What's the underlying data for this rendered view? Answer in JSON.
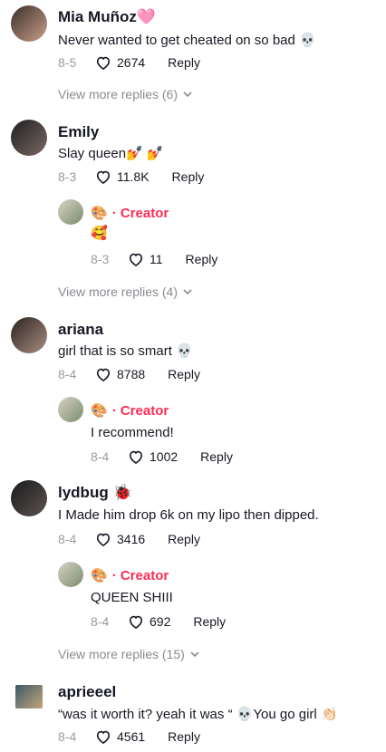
{
  "comments": [
    {
      "name": "Mia Muñoz🩷",
      "text": "Never wanted to get cheated on so bad",
      "emoji": "💀",
      "date": "8-5",
      "likes": "2674",
      "reply_label": "Reply",
      "more_replies": "View more replies (6)"
    },
    {
      "name": "Emily",
      "text": "Slay queen",
      "emoji": "💅 💅",
      "date": "8-3",
      "likes": "11.8K",
      "reply_label": "Reply",
      "reply": {
        "badge": "🎨",
        "creator": "· Creator",
        "text": "🥰",
        "date": "8-3",
        "likes": "11",
        "reply_label": "Reply"
      },
      "more_replies": "View more replies (4)"
    },
    {
      "name": "ariana",
      "text": "girl that is so smart",
      "emoji": "💀",
      "date": "8-4",
      "likes": "8788",
      "reply_label": "Reply",
      "reply": {
        "badge": "🎨",
        "creator": "· Creator",
        "text": "I recommend!",
        "date": "8-4",
        "likes": "1002",
        "reply_label": "Reply"
      }
    },
    {
      "name": "lydbug",
      "name_emoji": "🐞",
      "text": "I Made him drop 6k on my lipo then dipped.",
      "date": "8-4",
      "likes": "3416",
      "reply_label": "Reply",
      "reply": {
        "badge": "🎨",
        "creator": "· Creator",
        "text": "QUEEN SHIII",
        "date": "8-4",
        "likes": "692",
        "reply_label": "Reply"
      },
      "more_replies": "View more replies (15)"
    },
    {
      "name": "aprieeel",
      "text": "“was it worth it? yeah it was “",
      "emoji": "💀",
      "text2": "You go girl",
      "emoji2": "👏🏻",
      "date": "8-4",
      "likes": "4561",
      "reply_label": "Reply"
    }
  ],
  "colors": {
    "creator": "#fe2c55",
    "muted": "#8a8b91",
    "text": "#161823"
  },
  "icons": {
    "like": "heart-outline-icon",
    "expand": "chevron-down-icon"
  }
}
